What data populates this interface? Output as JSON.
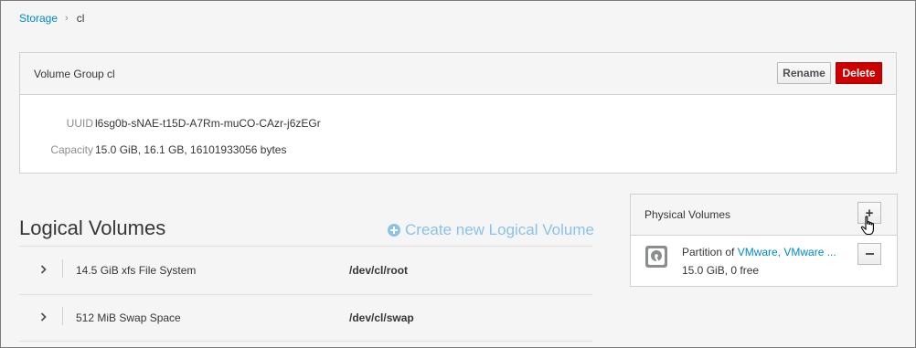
{
  "breadcrumb": {
    "root": "Storage",
    "separator": "›",
    "current": "cl"
  },
  "volume_group": {
    "title": "Volume Group cl",
    "rename_label": "Rename",
    "delete_label": "Delete",
    "uuid_label": "UUID",
    "uuid_value": "l6sg0b-sNAE-t15D-A7Rm-muCO-CAzr-j6zEGr",
    "capacity_label": "Capacity",
    "capacity_value": "15.0 GiB, 16.1 GB, 16101933056 bytes"
  },
  "logical_volumes": {
    "title": "Logical Volumes",
    "create_label": "Create new Logical Volume",
    "items": [
      {
        "description": "14.5 GiB xfs File System",
        "device": "/dev/cl/root"
      },
      {
        "description": "512 MiB Swap Space",
        "device": "/dev/cl/swap"
      }
    ]
  },
  "physical_volumes": {
    "title": "Physical Volumes",
    "add_label": "+",
    "items": [
      {
        "prefix": "Partition of ",
        "link": "VMware, VMware ...",
        "size": "15.0 GiB, 0 free",
        "icon": "disk-icon"
      }
    ]
  },
  "colors": {
    "link": "#0088ce",
    "delete": "#cc0000",
    "create_link": "#8ac3e8"
  }
}
